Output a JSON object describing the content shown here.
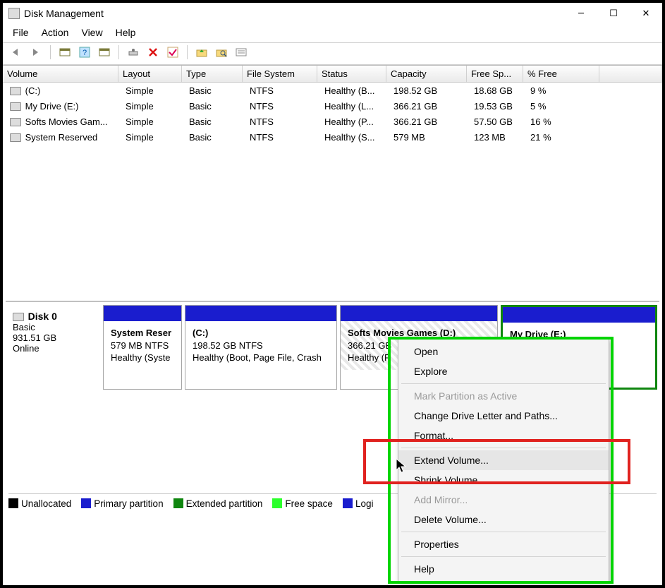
{
  "title": "Disk Management",
  "menus": {
    "file": "File",
    "action": "Action",
    "view": "View",
    "help": "Help"
  },
  "columns": [
    "Volume",
    "Layout",
    "Type",
    "File System",
    "Status",
    "Capacity",
    "Free Sp...",
    "% Free"
  ],
  "rows": [
    {
      "vol": "(C:)",
      "layout": "Simple",
      "type": "Basic",
      "fs": "NTFS",
      "status": "Healthy (B...",
      "cap": "198.52 GB",
      "free": "18.68 GB",
      "pct": "9 %"
    },
    {
      "vol": "My Drive (E:)",
      "layout": "Simple",
      "type": "Basic",
      "fs": "NTFS",
      "status": "Healthy (L...",
      "cap": "366.21 GB",
      "free": "19.53 GB",
      "pct": "5 %"
    },
    {
      "vol": "Softs Movies Gam...",
      "layout": "Simple",
      "type": "Basic",
      "fs": "NTFS",
      "status": "Healthy (P...",
      "cap": "366.21 GB",
      "free": "57.50 GB",
      "pct": "16 %"
    },
    {
      "vol": "System Reserved",
      "layout": "Simple",
      "type": "Basic",
      "fs": "NTFS",
      "status": "Healthy (S...",
      "cap": "579 MB",
      "free": "123 MB",
      "pct": "21 %"
    }
  ],
  "disk": {
    "name": "Disk 0",
    "type": "Basic",
    "size": "931.51 GB",
    "state": "Online"
  },
  "parts": {
    "p0": {
      "title": "System Reser",
      "line2": "579 MB NTFS",
      "line3": "Healthy (Syste"
    },
    "p1": {
      "title": "(C:)",
      "line2": "198.52 GB NTFS",
      "line3": "Healthy (Boot, Page File, Crash"
    },
    "p2": {
      "title": "Softs Movies Games  (D:)",
      "line2": "366.21 GB",
      "line3": "Healthy (P"
    },
    "p3": {
      "title": "My Drive  (E:)",
      "line2": "",
      "line3": ""
    }
  },
  "legend": {
    "unalloc": "Unallocated",
    "primary": "Primary partition",
    "extended": "Extended partition",
    "free": "Free space",
    "logical": "Logi"
  },
  "ctx": {
    "open": "Open",
    "explore": "Explore",
    "mark": "Mark Partition as Active",
    "change": "Change Drive Letter and Paths...",
    "format": "Format...",
    "extend": "Extend Volume...",
    "shrink": "Shrink Volume...",
    "mirror": "Add Mirror...",
    "delete": "Delete Volume...",
    "props": "Properties",
    "help": "Help"
  }
}
